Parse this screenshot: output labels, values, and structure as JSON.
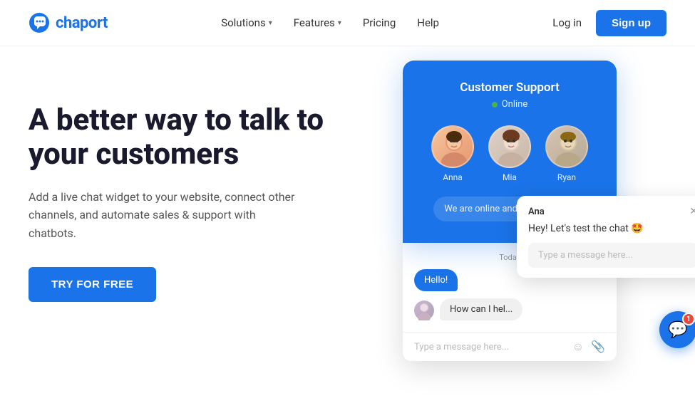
{
  "header": {
    "logo_text": "chaport",
    "nav": {
      "solutions_label": "Solutions",
      "features_label": "Features",
      "pricing_label": "Pricing",
      "help_label": "Help",
      "login_label": "Log in",
      "signup_label": "Sign up"
    }
  },
  "hero": {
    "headline": "A better way to talk to your customers",
    "subtext": "Add a live chat widget to your website, connect other channels, and automate sales & support with chatbots.",
    "cta_label": "TRY FOR FREE"
  },
  "chat_widget": {
    "panel_title": "Customer Support",
    "online_label": "Online",
    "tagline": "We are online and ready to help!",
    "agents": [
      {
        "name": "Anna"
      },
      {
        "name": "Mia"
      },
      {
        "name": "Ryan"
      }
    ],
    "date_label": "Today",
    "messages": [
      {
        "sender": "user",
        "text": "Hello!"
      },
      {
        "sender": "agent",
        "text": "How can I hel..."
      }
    ]
  },
  "chat_popup": {
    "agent_name": "Ana",
    "message": "Hey! Let's test the chat 🤩",
    "input_placeholder": "Type a message here..."
  },
  "chat_main_input": {
    "placeholder": "Type a message here..."
  },
  "fab": {
    "badge_count": "1"
  },
  "colors": {
    "brand_blue": "#1a73e8",
    "online_green": "#4caf50"
  }
}
